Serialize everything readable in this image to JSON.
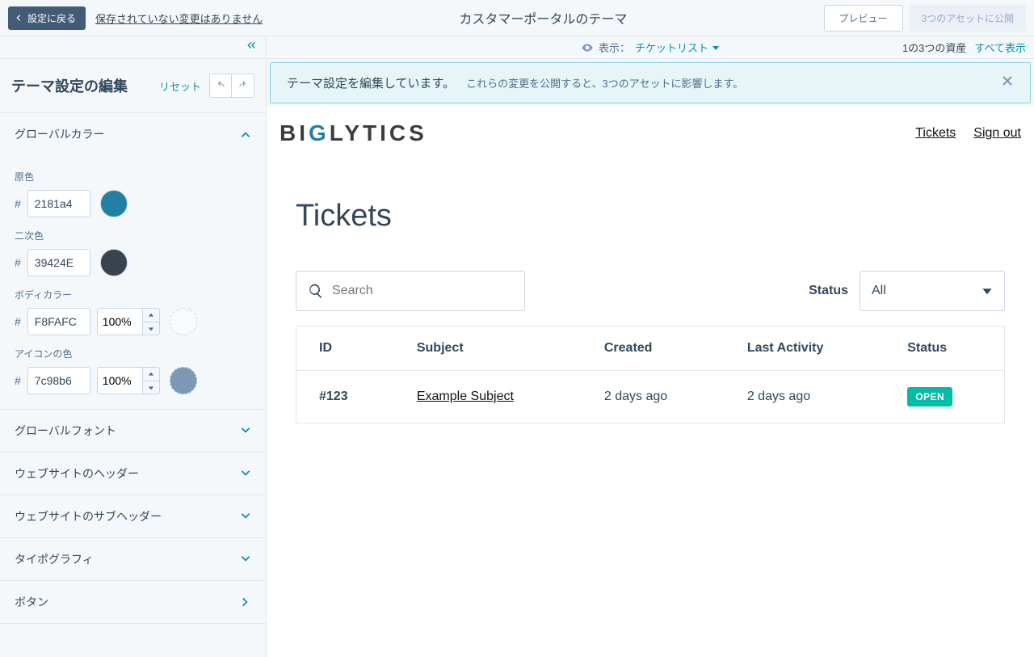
{
  "topbar": {
    "back": "設定に戻る",
    "unsaved": "保存されていない変更はありません",
    "title": "カスタマーポータルのテーマ",
    "preview": "プレビュー",
    "publish": "3つのアセットに公開"
  },
  "sidebar": {
    "collapse_icon": "collapse",
    "heading": "テーマ設定の編集",
    "reset": "リセット",
    "sections": {
      "global_color": {
        "title": "グローバルカラー",
        "open": true,
        "fields": {
          "primary": {
            "label": "原色",
            "hex": "2181a4",
            "color": "#2181a4"
          },
          "secondary": {
            "label": "二次色",
            "hex": "39424E",
            "color": "#39424E"
          },
          "body": {
            "label": "ボディカラー",
            "hex": "F8FAFC",
            "pct": "100%",
            "color": "#F8FAFC"
          },
          "icon": {
            "label": "アイコンの色",
            "hex": "7c98b6",
            "pct": "100%",
            "color": "#7c98b6"
          }
        }
      },
      "global_font": {
        "title": "グローバルフォント"
      },
      "website_header": {
        "title": "ウェブサイトのヘッダー"
      },
      "website_subheader": {
        "title": "ウェブサイトのサブヘッダー"
      },
      "typography": {
        "title": "タイポグラフィ"
      },
      "button": {
        "title": "ボタン"
      }
    }
  },
  "viewrow": {
    "label": "表示：",
    "select": "チケットリスト",
    "asset_count": "1の3つの資産",
    "show_all": "すべて表示"
  },
  "banner": {
    "headline": "テーマ設定を編集しています。",
    "sub": "これらの変更を公開すると、3つのアセットに影響します。"
  },
  "preview": {
    "logo_text": "BIGLYTICS",
    "nav_tickets": "Tickets",
    "nav_signout": "Sign out",
    "page_title": "Tickets",
    "search_placeholder": "Search",
    "status_label": "Status",
    "status_value": "All",
    "columns": {
      "id": "ID",
      "subject": "Subject",
      "created": "Created",
      "last": "Last Activity",
      "status": "Status"
    },
    "rows": [
      {
        "id": "#123",
        "subject": "Example Subject",
        "created": "2 days ago",
        "last": "2 days ago",
        "status": "OPEN"
      }
    ]
  }
}
